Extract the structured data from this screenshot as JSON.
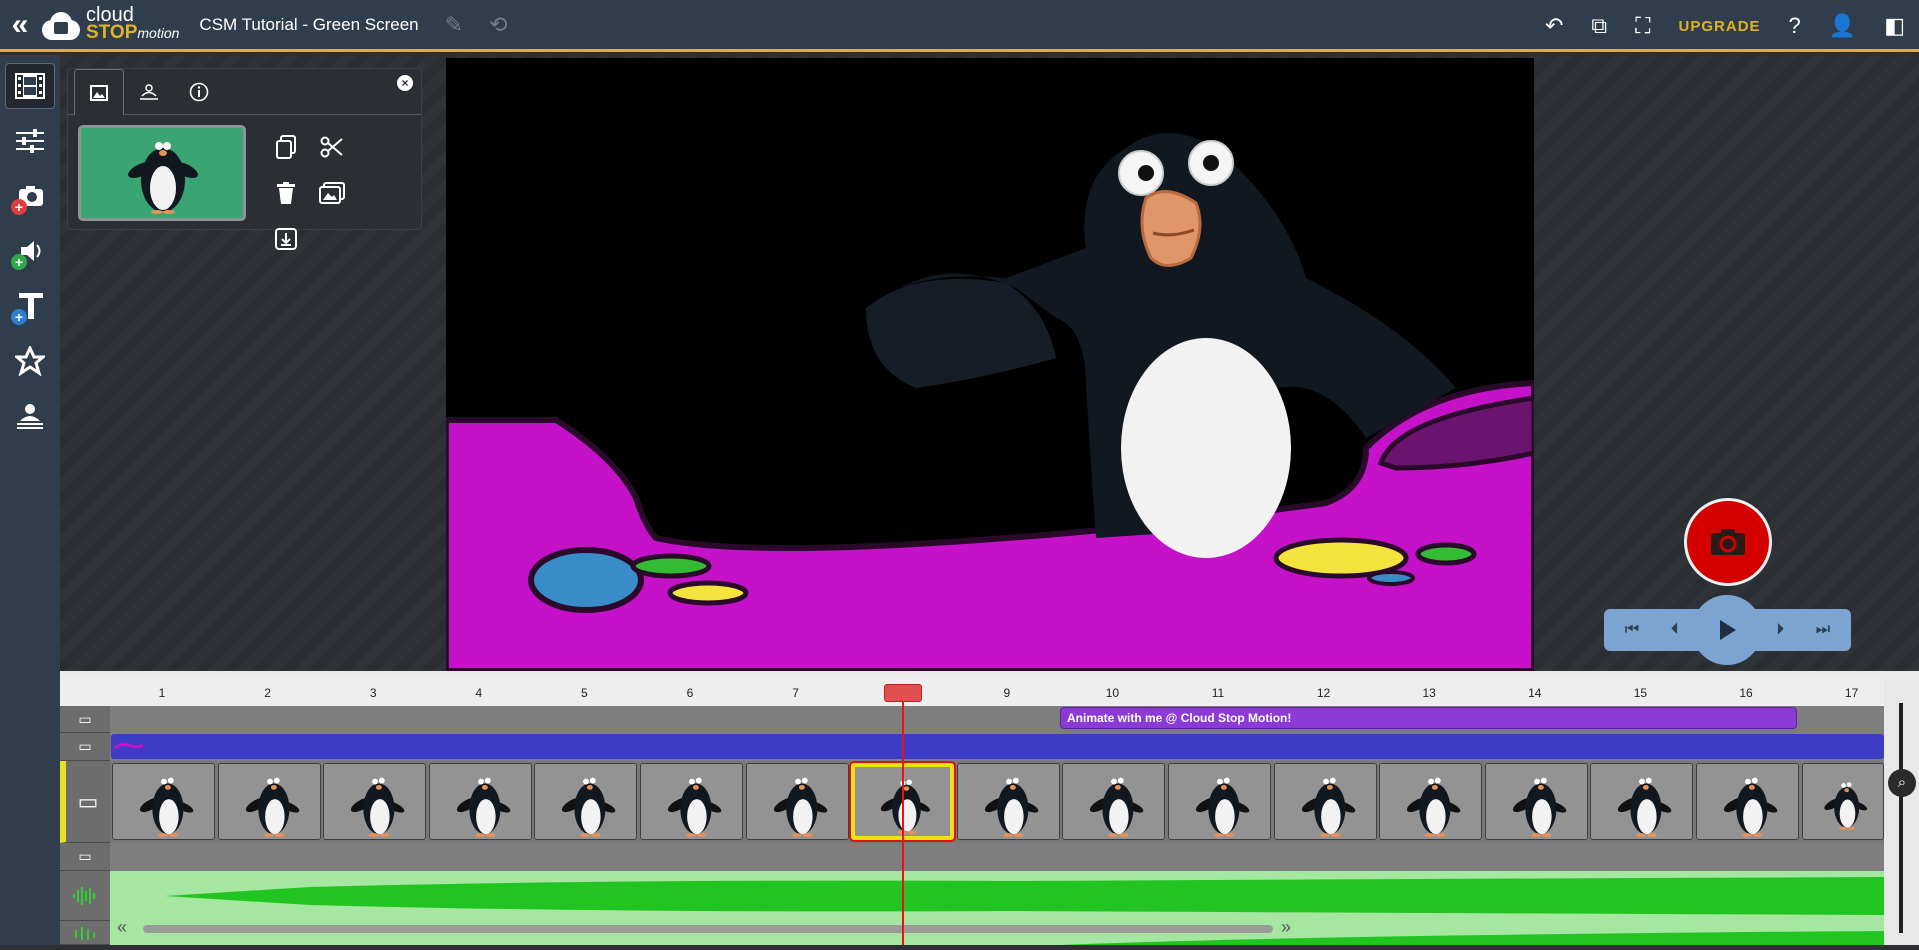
{
  "app": {
    "logo_line1": "cloud",
    "logo_line2": "STOP",
    "logo_line3": "motion"
  },
  "header": {
    "project_title": "CSM Tutorial - Green Screen",
    "upgrade_label": "UPGRADE",
    "accent_color": "#e0b325"
  },
  "sidebar": {
    "items": [
      {
        "name": "frames",
        "icon": "film-icon"
      },
      {
        "name": "adjustments",
        "icon": "sliders-icon"
      },
      {
        "name": "add-camera",
        "icon": "camera-add-icon"
      },
      {
        "name": "add-audio",
        "icon": "audio-add-icon"
      },
      {
        "name": "add-text",
        "icon": "text-add-icon"
      },
      {
        "name": "effects",
        "icon": "star-icon"
      },
      {
        "name": "green-screen",
        "icon": "greenscreen-icon"
      }
    ]
  },
  "frame_panel": {
    "tabs": [
      "image-icon",
      "greenscreen-icon",
      "info-icon"
    ],
    "actions": [
      "copy-icon",
      "cut-icon",
      "delete-icon",
      "images-icon",
      "download-icon"
    ]
  },
  "timeline": {
    "ticks": [
      "1",
      "2",
      "3",
      "4",
      "5",
      "6",
      "7",
      "8",
      "9",
      "10",
      "11",
      "12",
      "13",
      "14",
      "15",
      "16",
      "17"
    ],
    "text_clip": "Animate with me @  Cloud Stop Motion!",
    "frame_count_visible": 17,
    "selected_frame": 8,
    "scroll_left": "«",
    "scroll_right": "»"
  },
  "player": {
    "record_color": "#d40000",
    "play_color": "#7ba4d0"
  }
}
